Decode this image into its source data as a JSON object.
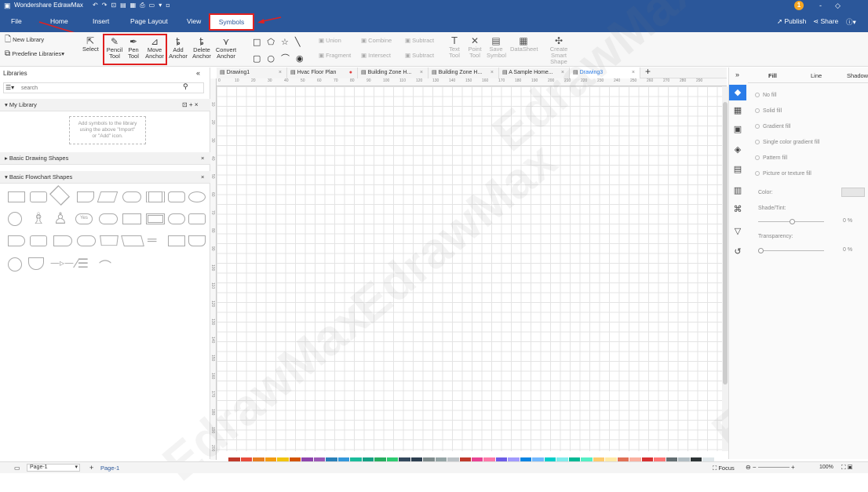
{
  "app": {
    "title": "Wondershare EdrawMax",
    "quick_access": [
      "↶",
      "↷",
      "⊡",
      "▤",
      "▦",
      "⎙",
      "▭",
      "▾",
      "▫"
    ],
    "user_badge": "1",
    "window_controls": [
      "|",
      "-",
      "◇"
    ]
  },
  "menu": {
    "items": [
      "File",
      "Home",
      "Insert",
      "Page Layout",
      "View",
      "Symbols"
    ],
    "publish": "Publish",
    "share": "Share",
    "help": "?"
  },
  "ribbon": {
    "new_library": "New Library",
    "predefine_libraries": "Predefine Libraries",
    "select": "Select",
    "pencil_tool": [
      "Pencil",
      "Tool"
    ],
    "pen_tool": [
      "Pen",
      "Tool"
    ],
    "move_anchor": [
      "Move",
      "Anchor"
    ],
    "add_anchor": [
      "Add",
      "Anchor"
    ],
    "delete_anchor": [
      "Delete",
      "Anchor"
    ],
    "convert_anchor": [
      "Convert",
      "Anchor"
    ],
    "union": "Union",
    "combine": "Combine",
    "subtract": "Subtract",
    "fragment": "Fragment",
    "intersect": "Intersect",
    "subtract2": "Subtract",
    "text_tool": [
      "Text",
      "Tool"
    ],
    "point_tool": [
      "Point",
      "Tool"
    ],
    "save_symbol": [
      "Save",
      "Symbol"
    ],
    "datasheet": "DataSheet",
    "create_smart_shape": [
      "Create Smart",
      "Shape"
    ]
  },
  "library": {
    "title": "Libraries",
    "search_placeholder": "search",
    "my_library": "My Library",
    "empty_hint": [
      "Add symbols to the library",
      "using the above \"Import\"",
      "or \"Add\" icon."
    ],
    "basic_drawing": "Basic Drawing Shapes",
    "basic_flowchart": "Basic Flowchart Shapes",
    "yes_shape_label": "Yes"
  },
  "tabs": [
    {
      "label": "Drawing1",
      "dot": false
    },
    {
      "label": "Hvac Floor Plan",
      "dot": true
    },
    {
      "label": "Building Zone H...",
      "dot": false
    },
    {
      "label": "Building Zone H...",
      "dot": false
    },
    {
      "label": "A Sample Home...",
      "dot": false
    },
    {
      "label": "Drawing3",
      "dot": false,
      "active": true
    }
  ],
  "ruler": {
    "h_ticks": [
      "0",
      "10",
      "20",
      "30",
      "40",
      "50",
      "60",
      "70",
      "80",
      "90",
      "100",
      "110",
      "120",
      "130",
      "140",
      "150",
      "160",
      "170",
      "180",
      "190",
      "200",
      "210",
      "220",
      "230",
      "240",
      "250",
      "260",
      "270",
      "280",
      "290"
    ],
    "v_ticks": [
      "10",
      "20",
      "30",
      "40",
      "50",
      "60",
      "70",
      "80",
      "90",
      "100",
      "110",
      "120",
      "130",
      "140",
      "150",
      "160",
      "170",
      "180",
      "190",
      "200"
    ]
  },
  "right_panel": {
    "tabs": [
      "Fill",
      "Line",
      "Shadow"
    ],
    "options": [
      "No fill",
      "Solid fill",
      "Gradient fill",
      "Single color gradient fill",
      "Pattern fill",
      "Picture or texture fill"
    ],
    "color_label": "Color:",
    "shade_label": "Shade/Tint:",
    "shade_value": "0 %",
    "transparency_label": "Transparency:",
    "transparency_value": "0 %"
  },
  "status": {
    "page_select": "Page-1",
    "page_tab": "Page-1",
    "focus": "Focus",
    "zoom": "100%"
  },
  "watermark": "EdrawMax",
  "palette": [
    "#c0392b",
    "#e74c3c",
    "#e67e22",
    "#f39c12",
    "#f1c40f",
    "#d35400",
    "#8e44ad",
    "#9b59b6",
    "#2980b9",
    "#3498db",
    "#1abc9c",
    "#16a085",
    "#27ae60",
    "#2ecc71",
    "#34495e",
    "#2c3e50",
    "#7f8c8d",
    "#95a5a6",
    "#bdc3c7",
    "#c0392b",
    "#e84393",
    "#fd79a8",
    "#6c5ce7",
    "#a29bfe",
    "#0984e3",
    "#74b9ff",
    "#00cec9",
    "#81ecec",
    "#00b894",
    "#55efc4",
    "#fdcb6e",
    "#ffeaa7",
    "#e17055",
    "#fab1a0",
    "#d63031",
    "#ff7675",
    "#636e72",
    "#b2bec3",
    "#2d3436",
    "#dfe6e9"
  ]
}
